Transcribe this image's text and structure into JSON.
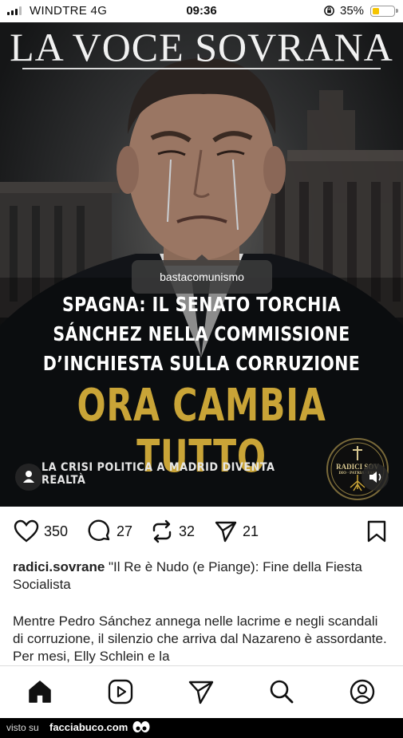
{
  "status_bar": {
    "carrier": "WINDTRE  4G",
    "time": "09:36",
    "battery_percent": "35%",
    "battery_level": 0.35
  },
  "post": {
    "masthead": "LA VOCE SOVRANA",
    "tag_tooltip": "bastacomunismo",
    "headline_lines": [
      "SPAGNA: IL SENATO TORCHIA",
      "SÁNCHEZ NELLA COMMISSIONE",
      "D’INCHIESTA SULLA CORRUZIONE"
    ],
    "big_title": "ORA CAMBIA TUTTO",
    "subtitle": "LA CRISI POLITICA A MADRID DIVENTA REALTÀ",
    "seal": {
      "name": "RADICI SOV",
      "motto": "DIO · PATRIA · FAM"
    },
    "colors": {
      "gold": "#c9a437"
    }
  },
  "actions": {
    "likes": "350",
    "comments": "27",
    "reposts": "32",
    "shares": "21"
  },
  "caption": {
    "username": "radici.sovrane",
    "text": "\"Il Re è Nudo (e Piange): Fine della Fiesta Socialista",
    "body": "Mentre Pedro Sánchez annega nelle lacrime e negli scandali di corruzione, il silenzio che arriva dal Nazareno è assordante. Per mesi, Elly Schlein e la"
  },
  "nav": {
    "icons": [
      "home-icon",
      "reels-icon",
      "send-icon",
      "search-icon",
      "profile-icon"
    ]
  },
  "footer": {
    "visto_su": "visto su",
    "site": "facciabuco.com"
  }
}
